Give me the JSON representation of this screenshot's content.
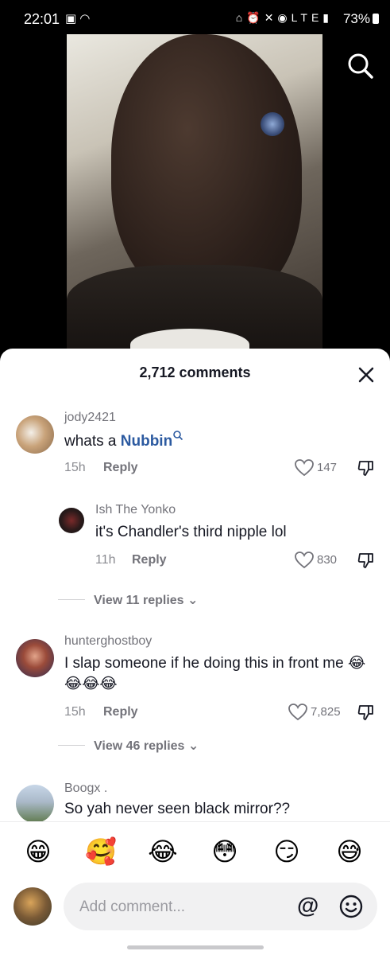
{
  "status_bar": {
    "time": "22:01",
    "left_icons": [
      "gallery-icon",
      "wifi-icon"
    ],
    "right_icons": [
      "sleep-icon",
      "alarm-icon",
      "mute-icon",
      "hotspot-icon",
      "lte-icon",
      "signal-icon"
    ],
    "lte": "LTE",
    "battery": "73%"
  },
  "header": {
    "comment_count": "2,712 comments"
  },
  "comments": [
    {
      "username": "jody2421",
      "text_before": "whats a ",
      "highlight": "Nubbin",
      "time": "15h",
      "reply": "Reply",
      "likes": "147"
    },
    {
      "username": "Ish The Yonko",
      "text": "it's Chandler's third nipple lol",
      "time": "11h",
      "reply": "Reply",
      "likes": "830"
    },
    {
      "view_replies": "View 11 replies"
    },
    {
      "username": "hunterghostboy",
      "text": "I slap someone if he doing this in front me 😂😂😂😂",
      "time": "15h",
      "reply": "Reply",
      "likes": "7,825"
    },
    {
      "view_replies": "View 46 replies"
    },
    {
      "username": "Boogx .",
      "text": "So yah never seen black mirror??"
    }
  ],
  "emoji_bar": [
    "😁",
    "🥰",
    "😂",
    "😳",
    "😏",
    "😅"
  ],
  "input": {
    "placeholder": "Add comment...",
    "at": "@"
  },
  "colors": {
    "sheet_bg": "#ffffff",
    "primary_text": "#161823",
    "secondary_text": "#73737a",
    "link": "#2c5aa0"
  }
}
